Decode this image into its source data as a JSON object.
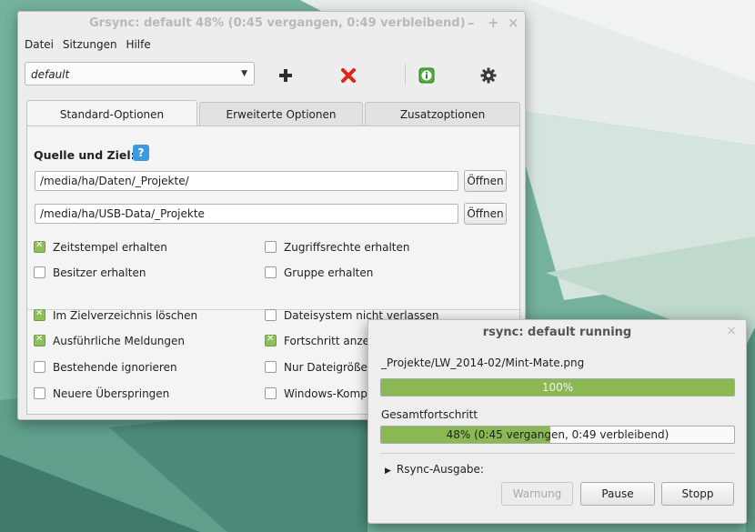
{
  "main_window": {
    "title": "Grsync: default 48% (0:45 vergangen, 0:49 verbleibend)",
    "controls": {
      "minimize": "–",
      "maximize": "+",
      "close": "×"
    },
    "menu": [
      "Datei",
      "Sitzungen",
      "Hilfe"
    ],
    "session_select": {
      "value": "default"
    },
    "toolbar": {
      "add_icon": "plus-icon",
      "delete_icon": "red-x-icon",
      "info_icon": "info-icon",
      "settings_icon": "gear-icon"
    },
    "tabs": [
      {
        "label": "Standard-Optionen",
        "active": true
      },
      {
        "label": "Erweiterte Optionen",
        "active": false
      },
      {
        "label": "Zusatzoptionen",
        "active": false
      }
    ],
    "source_dest": {
      "title": "Quelle und Ziel:",
      "help_icon": "help-icon",
      "source": "/media/ha/Daten/_Projekte/",
      "destination": "/media/ha/USB-Data/_Projekte",
      "open_label": "Öffnen"
    },
    "options_top": [
      {
        "label": "Zeitstempel erhalten",
        "checked": true
      },
      {
        "label": "Zugriffsrechte erhalten",
        "checked": false
      },
      {
        "label": "Besitzer erhalten",
        "checked": false
      },
      {
        "label": "Gruppe erhalten",
        "checked": false
      }
    ],
    "options_bottom": [
      {
        "label": "Im Zielverzeichnis löschen",
        "checked": true
      },
      {
        "label": "Dateisystem nicht verlassen",
        "checked": false
      },
      {
        "label": "Ausführliche Meldungen",
        "checked": true
      },
      {
        "label": "Fortschritt anzei",
        "checked": true
      },
      {
        "label": "Bestehende ignorieren",
        "checked": false
      },
      {
        "label": "Nur Dateigröße v",
        "checked": false
      },
      {
        "label": "Neuere Überspringen",
        "checked": false
      },
      {
        "label": "Windows-Kompa",
        "checked": false
      }
    ]
  },
  "progress_dialog": {
    "title": "rsync: default running",
    "close": "×",
    "current_file": "_Projekte/LW_2014-02/Mint-Mate.png",
    "file_progress": {
      "fraction": 1.0,
      "text": "100%"
    },
    "overall_label": "Gesamtfortschritt",
    "overall_progress": {
      "fraction": 0.48,
      "text": "48% (0:45 vergangen, 0:49 verbleibend)"
    },
    "expander": {
      "icon": "triangle-right-icon",
      "label": "Rsync-Ausgabe:"
    },
    "buttons": {
      "warning": "Warnung",
      "pause": "Pause",
      "stop": "Stopp"
    }
  },
  "colors": {
    "progress_fill": "#8ab954",
    "checkbox_on": "#8fbf5b",
    "help_blue": "#3c9be0"
  }
}
